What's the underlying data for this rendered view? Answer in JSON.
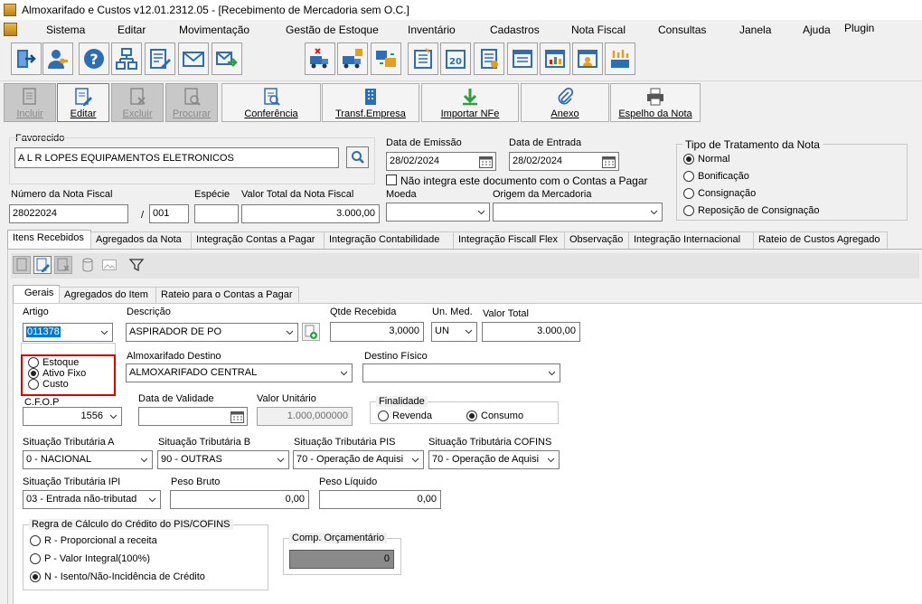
{
  "window": {
    "title": "Almoxarifado e Custos v12.01.2312.05 - [Recebimento de Mercadoria sem O.C.]"
  },
  "menu": [
    "Sistema",
    "Editar",
    "Movimentação",
    "Gestão de Estoque",
    "Inventário",
    "Cadastros",
    "Nota Fiscal",
    "Consultas",
    "Janela",
    "Ajuda",
    "Plugin"
  ],
  "actions": {
    "incluir": "Incluir",
    "editar": "Editar",
    "excluir": "Excluir",
    "procurar": "Procurar",
    "conferencia": "Conferência",
    "transf": "Transf.Empresa",
    "importar": "Importar NFe",
    "anexo": "Anexo",
    "espelho": "Espelho da Nota"
  },
  "header": {
    "favorecido_label": "Favorecido",
    "favorecido_value": "A L R LOPES EQUIPAMENTOS ELETRONICOS",
    "data_emissao_label": "Data de Emissão",
    "data_emissao_value": "28/02/2024",
    "data_entrada_label": "Data de Entrada",
    "data_entrada_value": "28/02/2024",
    "nao_integra_label": "Não integra este documento com o Contas a Pagar",
    "numero_nf_label": "Número da Nota Fiscal",
    "numero_nf_value": "28022024",
    "serie_sep": "/",
    "serie_value": "001",
    "especie_label": "Espécie",
    "especie_value": "",
    "valor_total_label": "Valor Total da Nota Fiscal",
    "valor_total_value": "3.000,00",
    "moeda_label": "Moeda",
    "moeda_value": "",
    "origem_label": "Origem da Mercadoria",
    "origem_value": ""
  },
  "tipo_tratamento": {
    "title": "Tipo de Tratamento da Nota",
    "options": [
      "Normal",
      "Bonificação",
      "Consignação",
      "Reposição de Consignação"
    ]
  },
  "main_tabs": [
    "Itens Recebidos",
    "Agregados da Nota",
    "Integração Contas a Pagar",
    "Integração Contabilidade",
    "Integração Fiscall Flex",
    "Observação",
    "Integração Internacional",
    "Rateio de Custos Agregado"
  ],
  "sub_tabs": [
    "Gerais",
    "Agregados do Item",
    "Rateio para o Contas a Pagar"
  ],
  "item": {
    "artigo_label": "Artigo",
    "artigo_value": "011378",
    "descricao_label": "Descrição",
    "descricao_value": "ASPIRADOR DE PO",
    "qtde_label": "Qtde Recebida",
    "qtde_value": "3,0000",
    "un_med_label": "Un. Med.",
    "un_med_value": "UN",
    "valor_total_label": "Valor Total",
    "valor_total_value": "3.000,00",
    "tipo_options": [
      "Estoque",
      "Ativo Fixo",
      "Custo"
    ],
    "almox_label": "Almoxarifado Destino",
    "almox_value": "ALMOXARIFADO CENTRAL",
    "destino_label": "Destino Físico",
    "destino_value": "",
    "cfop_label": "C.F.O.P",
    "cfop_value": "1556",
    "validade_label": "Data de Validade",
    "validade_value": "",
    "valor_unit_label": "Valor Unitário",
    "valor_unit_value": "1.000,000000",
    "finalidade_title": "Finalidade",
    "finalidade_options": [
      "Revenda",
      "Consumo"
    ],
    "sit_a_label": "Situação Tributária A",
    "sit_a_value": "0  -  NACIONAL",
    "sit_b_label": "Situação Tributária B",
    "sit_b_value": "90  -  OUTRAS",
    "sit_pis_label": "Situação Tributária PIS",
    "sit_pis_value": "70 - Operação de Aquisi",
    "sit_cofins_label": "Situação Tributária COFINS",
    "sit_cofins_value": "70 - Operação de Aquisi",
    "sit_ipi_label": "Situação Tributária IPI",
    "sit_ipi_value": "03 - Entrada não-tributad",
    "peso_bruto_label": "Peso Bruto",
    "peso_bruto_value": "0,00",
    "peso_liq_label": "Peso Líquido",
    "peso_liq_value": "0,00",
    "regra_title": "Regra de Cálculo do Crédito do PIS/COFINS",
    "regra_options": [
      "R - Proporcional a receita",
      "P - Valor Integral(100%)",
      "N - Isento/Não-Incidência de Crédito"
    ],
    "comp_title": "Comp. Orçamentário",
    "comp_value": "0"
  },
  "colors": {
    "highlight_box": "#e00000",
    "selection": "#0078d7"
  }
}
